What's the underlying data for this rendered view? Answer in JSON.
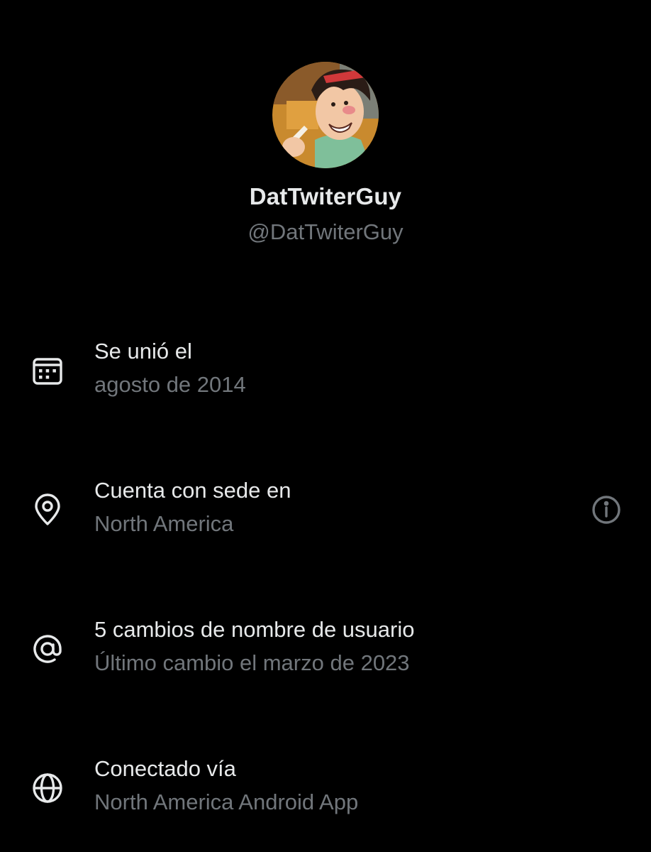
{
  "profile": {
    "display_name": "DatTwiterGuy",
    "handle": "@DatTwiterGuy"
  },
  "rows": [
    {
      "icon": "calendar-icon",
      "primary": "Se unió el",
      "secondary": "agosto de 2014"
    },
    {
      "icon": "location-pin-icon",
      "primary": "Cuenta con sede en",
      "secondary": "North America",
      "action_icon": "info-icon"
    },
    {
      "icon": "at-sign-icon",
      "primary": "5 cambios de nombre de usuario",
      "secondary": "Último cambio el marzo de 2023"
    },
    {
      "icon": "globe-icon",
      "primary": "Conectado vía",
      "secondary": "North America Android App"
    }
  ],
  "colors": {
    "background": "#000000",
    "primary_text": "#e7e9ea",
    "secondary_text": "#71767b"
  }
}
